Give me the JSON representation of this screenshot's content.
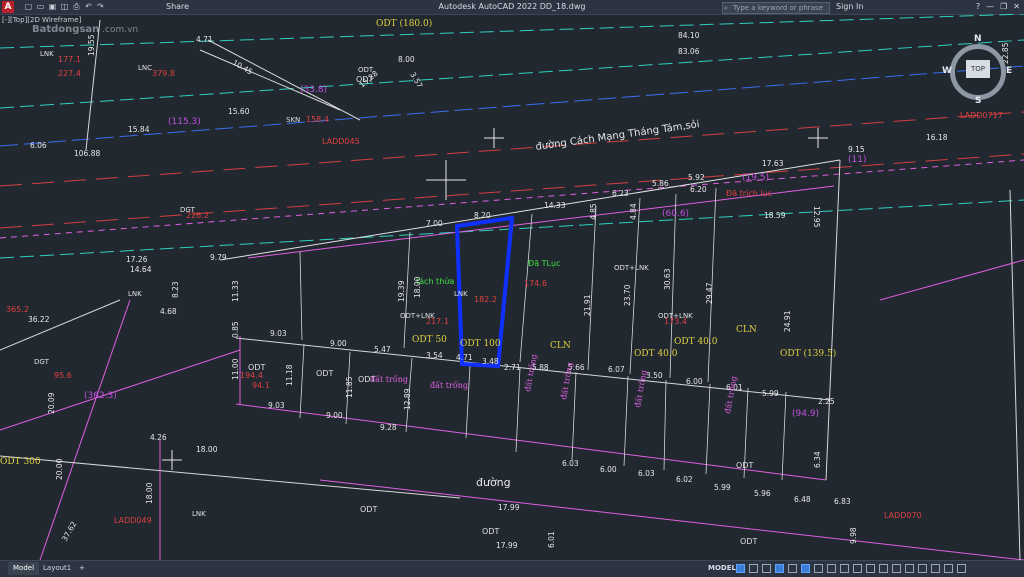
{
  "app": {
    "title": "Autodesk AutoCAD 2022   DD_18.dwg",
    "logo": "A",
    "share": "Share",
    "search_placeholder": "Type a keyword or phrase",
    "sign_in": "Sign In",
    "viewport_label": "[-][Top][2D Wireframe]",
    "watermark": "Batdongsan",
    "watermark_sub": ".com.vn",
    "quick_access_icons": [
      "new-icon",
      "open-icon",
      "save-icon",
      "saveas-icon",
      "plot-icon",
      "undo-icon",
      "redo-icon"
    ]
  },
  "viewcube": {
    "n": "N",
    "s": "S",
    "w": "W",
    "e": "E",
    "top": "TOP"
  },
  "status": {
    "tabs": [
      "Model",
      "Layout1",
      "+"
    ],
    "model_button": "MODEL"
  },
  "drawing": {
    "road_label": "đường Cách Mạng Tháng Tám,sỏi",
    "lower_road": "đường",
    "dims": [
      "84.10",
      "83.06",
      "15.60",
      "15.84",
      "106.88",
      "6.06",
      "10.45",
      "4.71",
      "8.00",
      "3.57",
      "15.28",
      "8.20",
      "7.00",
      "14.33",
      "6.23",
      "5.86",
      "5.92",
      "6.20",
      "17.63",
      "9.15",
      "16.18",
      "12.95",
      "18.59",
      "17.26",
      "14.64",
      "9.79",
      "11.33",
      "9.03",
      "9.00",
      "5.47",
      "3.54",
      "4.71",
      "3.48",
      "2.71",
      "5.88",
      "5.66",
      "6.07",
      "3.50",
      "6.00",
      "6.01",
      "5.99",
      "11.00",
      "11.18",
      "11.85",
      "9.28",
      "12.89",
      "9.03",
      "9.00",
      "6.03",
      "6.00",
      "6.03",
      "6.02",
      "5.99",
      "5.96",
      "6.48",
      "6.83",
      "20.09",
      "36.22",
      "4.26",
      "18.00",
      "20.00",
      "18.00",
      "17.99",
      "17.99",
      "6.01",
      "37.62",
      "9.98",
      "18.00",
      "19.39",
      "24.91",
      "21.91",
      "23.70",
      "29.47",
      "30.63",
      "4.85",
      "4.84",
      "6.34",
      "2.25",
      "0.85",
      "19.55",
      "22.85",
      "8.23",
      "4.68"
    ],
    "zones": {
      "odt_180": "ODT\n(180.0)",
      "odt_33": "(33.8)",
      "odt_115": "(115.3)",
      "odt_50": "ODT 50",
      "odt_100": "ODT 100",
      "cln": "CLN",
      "cln2": "CLN",
      "odt_40a": "ODT 40.0",
      "odt_40b": "ODT 40.0",
      "odt_139": "ODT\n(139.5)",
      "odt_300": "ODT 300",
      "p_362": "(362.3)",
      "p_94": "(94.9)",
      "p_60": "(60.6)",
      "p_19": "(19.5)",
      "p_11": "(11)",
      "tach_thua": "tách thửa",
      "da_tluc": "Đã TLục",
      "da_trich_luc": "Đã trích lục",
      "lad1": "LADD045",
      "lad2": "LADD049",
      "lad3": "LADD070",
      "lad4": "LADD0717"
    },
    "lot_tags": [
      "LNK",
      "DGT",
      "SKN",
      "ODT",
      "LNC",
      "ODT+LNK",
      "LNK",
      "ODT+LNK",
      "ODT+LNK",
      "LNK",
      "DGT",
      "LNK"
    ],
    "parcel_values": [
      "177.1",
      "227.4",
      "379.8",
      "226.2",
      "158.4",
      "182.2",
      "174.6",
      "173.4",
      "217.1",
      "365.2",
      "95.6",
      "194.4",
      "94.1"
    ],
    "odt_labels": [
      "ODT",
      "ODT",
      "ODT",
      "ODT",
      "ODT",
      "ODT",
      "ODT",
      "ODT"
    ],
    "dat_trong": [
      "đất trống",
      "đất trống",
      "đất trống",
      "đất trống",
      "đất trống",
      "đất trống"
    ]
  }
}
